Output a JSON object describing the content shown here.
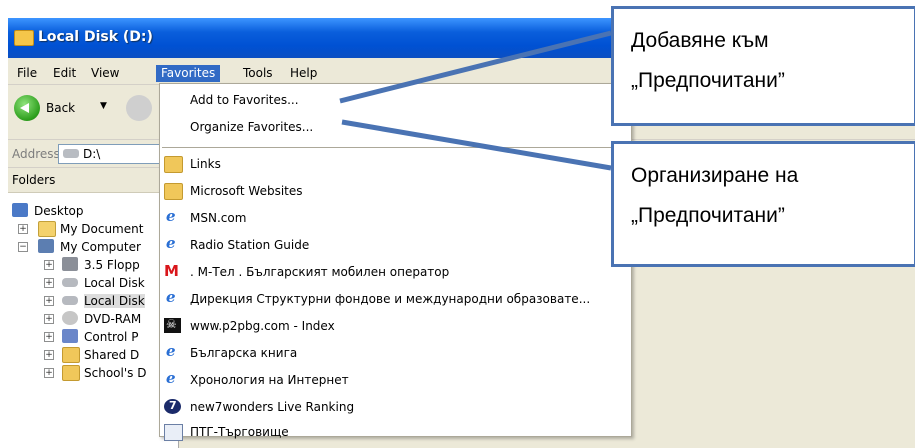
{
  "window": {
    "title": "Local Disk (D:)"
  },
  "menubar": {
    "items": [
      "File",
      "Edit",
      "View",
      "Favorites",
      "Tools",
      "Help"
    ]
  },
  "toolbar": {
    "back_label": "Back",
    "back_arrow": "▼"
  },
  "address": {
    "label": "Address",
    "value": "D:\\"
  },
  "folders_pane": {
    "header": "Folders",
    "items": [
      {
        "label": "Desktop",
        "expander": "",
        "icon": "desktop-icon"
      },
      {
        "label": "My Document",
        "expander": "+",
        "icon": "my-documents-icon"
      },
      {
        "label": "My Computer",
        "expander": "−",
        "icon": "my-computer-icon"
      },
      {
        "label": "3.5 Flopp",
        "expander": "+",
        "icon": "floppy-drive-icon"
      },
      {
        "label": "Local Disk",
        "expander": "+",
        "icon": "local-disk-icon"
      },
      {
        "label": "Local Disk",
        "expander": "+",
        "icon": "local-disk-icon"
      },
      {
        "label": "DVD-RAM",
        "expander": "+",
        "icon": "dvd-drive-icon"
      },
      {
        "label": "Control P",
        "expander": "+",
        "icon": "control-panel-icon"
      },
      {
        "label": "Shared D",
        "expander": "+",
        "icon": "shared-folder-icon"
      },
      {
        "label": "School's D",
        "expander": "+",
        "icon": "folder-icon"
      }
    ]
  },
  "favorites_menu": {
    "add": "Add to Favorites...",
    "organize": "Organize Favorites...",
    "items": [
      {
        "label": "Links",
        "icon": "folder-icon"
      },
      {
        "label": "Microsoft Websites",
        "icon": "folder-icon"
      },
      {
        "label": "MSN.com",
        "icon": "ie-icon"
      },
      {
        "label": "Radio Station Guide",
        "icon": "ie-icon"
      },
      {
        "label": ". M-Тел . Българският мобилен оператор",
        "icon": "mtel-icon"
      },
      {
        "label": "Дирекция Структурни фондове и международни образовате...",
        "icon": "ie-icon"
      },
      {
        "label": "www.p2pbg.com - Index",
        "icon": "pirate-icon"
      },
      {
        "label": "Българска книга",
        "icon": "ie-icon"
      },
      {
        "label": "Хронология на Интернет",
        "icon": "ie-icon"
      },
      {
        "label": "new7wonders Live Ranking",
        "icon": "seven-icon"
      },
      {
        "label": "ПТГ-Търговище",
        "icon": "document-icon"
      }
    ]
  },
  "callouts": {
    "add": {
      "line1": "Добавяне към",
      "line2": "„Предпочитани”"
    },
    "organize": {
      "line1": "Организиране на",
      "line2": "„Предпочитани”"
    }
  },
  "colors": {
    "callout_border": "#4a73b3",
    "menu_highlight": "#316ac5",
    "titlebar": "#0a5fdc"
  }
}
